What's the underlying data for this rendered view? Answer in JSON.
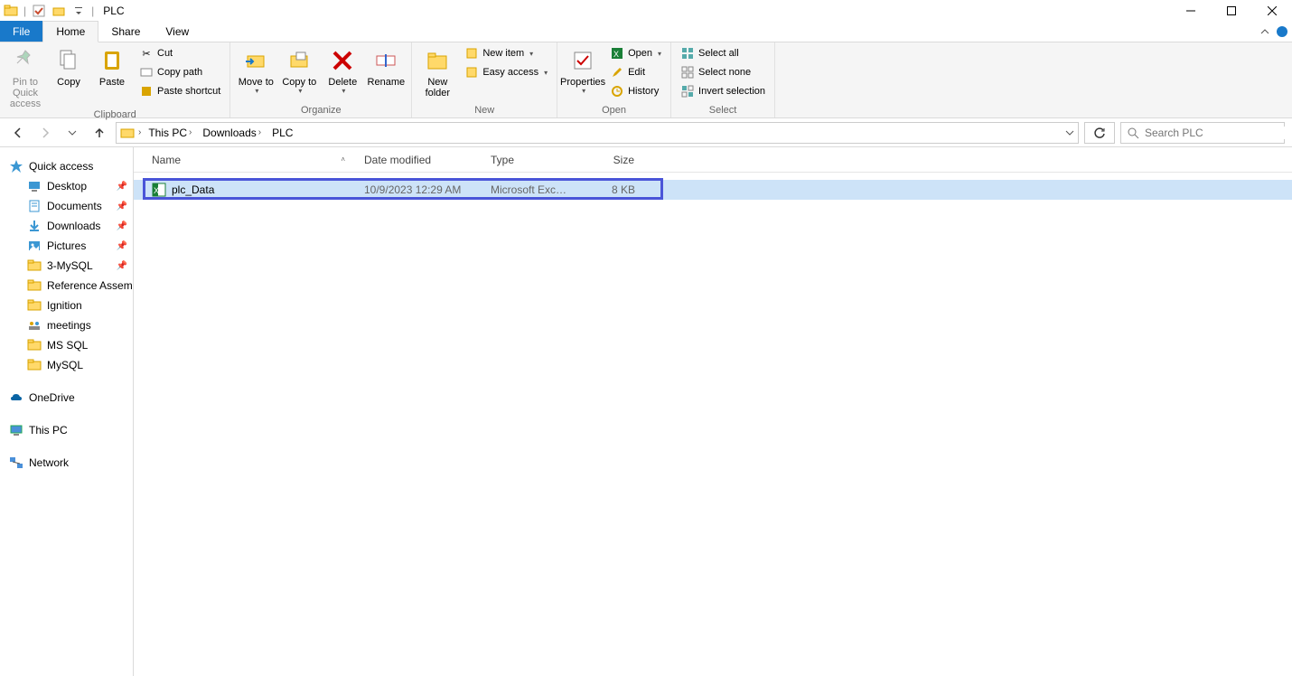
{
  "titlebar": {
    "app_title": "PLC"
  },
  "tabs": {
    "file": "File",
    "home": "Home",
    "share": "Share",
    "view": "View"
  },
  "ribbon": {
    "clipboard": {
      "title": "Clipboard",
      "pin": "Pin to Quick access",
      "copy": "Copy",
      "paste": "Paste",
      "cut": "Cut",
      "copy_path": "Copy path",
      "paste_shortcut": "Paste shortcut"
    },
    "organize": {
      "title": "Organize",
      "move_to": "Move to",
      "copy_to": "Copy to",
      "delete": "Delete",
      "rename": "Rename"
    },
    "new": {
      "title": "New",
      "new_folder": "New folder",
      "new_item": "New item",
      "easy_access": "Easy access"
    },
    "open": {
      "title": "Open",
      "properties": "Properties",
      "open": "Open",
      "edit": "Edit",
      "history": "History"
    },
    "select": {
      "title": "Select",
      "select_all": "Select all",
      "select_none": "Select none",
      "invert": "Invert selection"
    }
  },
  "breadcrumb": {
    "parts": [
      "This PC",
      "Downloads",
      "PLC"
    ]
  },
  "search": {
    "placeholder": "Search PLC"
  },
  "sidebar": {
    "quick_access": "Quick access",
    "items": [
      {
        "label": "Desktop",
        "pinned": true
      },
      {
        "label": "Documents",
        "pinned": true
      },
      {
        "label": "Downloads",
        "pinned": true
      },
      {
        "label": "Pictures",
        "pinned": true
      },
      {
        "label": "3-MySQL",
        "pinned": true
      },
      {
        "label": "Reference Assem",
        "pinned": true
      },
      {
        "label": "Ignition",
        "pinned": false
      },
      {
        "label": "meetings",
        "pinned": false
      },
      {
        "label": "MS SQL",
        "pinned": false
      },
      {
        "label": "MySQL",
        "pinned": false
      }
    ],
    "onedrive": "OneDrive",
    "this_pc": "This PC",
    "network": "Network"
  },
  "columns": {
    "name": "Name",
    "date": "Date modified",
    "type": "Type",
    "size": "Size"
  },
  "rows": [
    {
      "name": "plc_Data",
      "date": "10/9/2023 12:29 AM",
      "type": "Microsoft Excel W...",
      "size": "8 KB"
    }
  ]
}
